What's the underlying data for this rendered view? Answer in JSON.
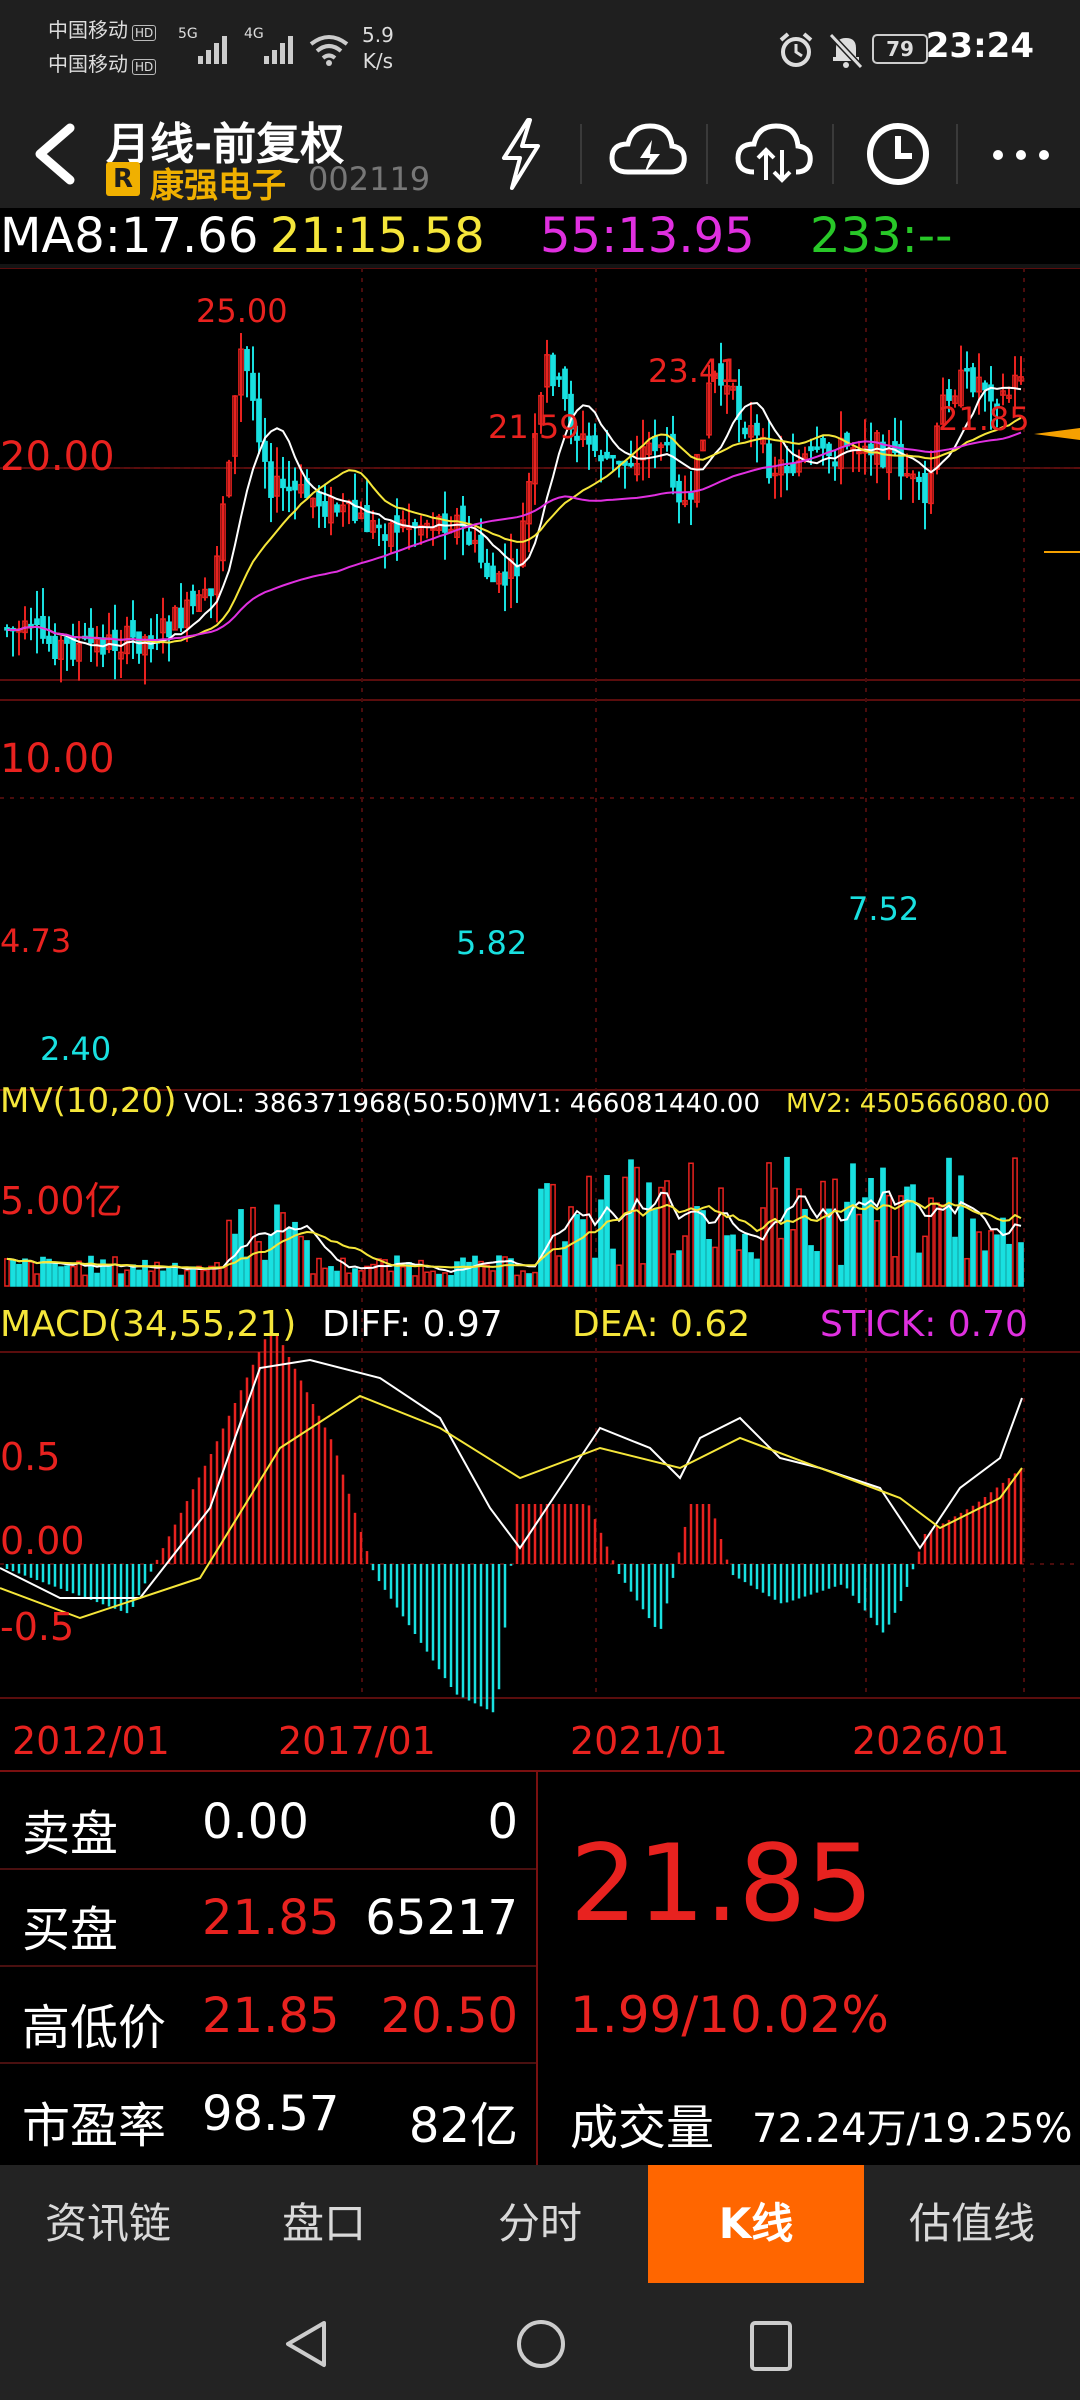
{
  "status_bar": {
    "carrier1": "中国移动",
    "carrier2": "中国移动",
    "hd": "HD",
    "net5g": "5G",
    "net4g": "4G",
    "speed_value": "5.9",
    "speed_unit": "K/s",
    "battery": "79",
    "time": "23:24"
  },
  "header": {
    "title": "月线-前复权",
    "badge": "R",
    "stock_name": "康强电子",
    "stock_code": "002119",
    "icons": [
      "lightning-icon",
      "cloud-lightning-icon",
      "cloud-sync-icon",
      "clock-icon",
      "more-icon"
    ]
  },
  "ma_line": {
    "ma8": "MA8:17.66",
    "ma21": "21:15.58",
    "ma55": "55:13.95",
    "ma233": "233:--"
  },
  "kline": {
    "y_labels": [
      "20.00",
      "10.00"
    ],
    "annotations": [
      {
        "text": "25.00",
        "type": "high"
      },
      {
        "text": "21.59",
        "type": "high"
      },
      {
        "text": "23.41",
        "type": "high"
      },
      {
        "text": "21.85",
        "type": "high"
      },
      {
        "text": "4.73",
        "type": "high"
      },
      {
        "text": "2.40",
        "type": "low"
      },
      {
        "text": "5.82",
        "type": "low"
      },
      {
        "text": "7.52",
        "type": "low"
      }
    ]
  },
  "volume": {
    "title": "MV(10,20)",
    "vol": "VOL: 386371968(50:50)",
    "mv1": "MV1: 466081440.00",
    "mv2": "MV2: 450566080.00",
    "y_label": "5.00亿"
  },
  "macd": {
    "title": "MACD(34,55,21)",
    "diff": "DIFF: 0.97",
    "dea": "DEA: 0.62",
    "stick": "STICK: 0.70",
    "y_labels": [
      "0.5",
      "0.00",
      "-0.5"
    ]
  },
  "date_axis": [
    "2012/01",
    "2017/01",
    "2021/01",
    "2026/01"
  ],
  "quote": {
    "sell_label": "卖盘",
    "sell_price": "0.00",
    "sell_vol": "0",
    "buy_label": "买盘",
    "buy_price": "21.85",
    "buy_vol": "65217",
    "hl_label": "高低价",
    "high": "21.85",
    "low": "20.50",
    "pe_label": "市盈率",
    "pe": "98.57",
    "mcap": "82亿",
    "price": "21.85",
    "change": "1.99/10.02%",
    "volume_label": "成交量",
    "volume": "72.24万/19.25%"
  },
  "nav": [
    {
      "label": "资讯链",
      "active": false
    },
    {
      "label": "盘口",
      "active": false
    },
    {
      "label": "分时",
      "active": false
    },
    {
      "label": "K线",
      "active": true
    },
    {
      "label": "估值线",
      "active": false
    }
  ],
  "colors": {
    "up": "#e8221f",
    "down": "#19e0e0",
    "ma8": "#ffffff",
    "ma21": "#f5e63a",
    "ma55": "#e030e0",
    "ma233": "#28c828",
    "accent": "#ff6600"
  }
}
